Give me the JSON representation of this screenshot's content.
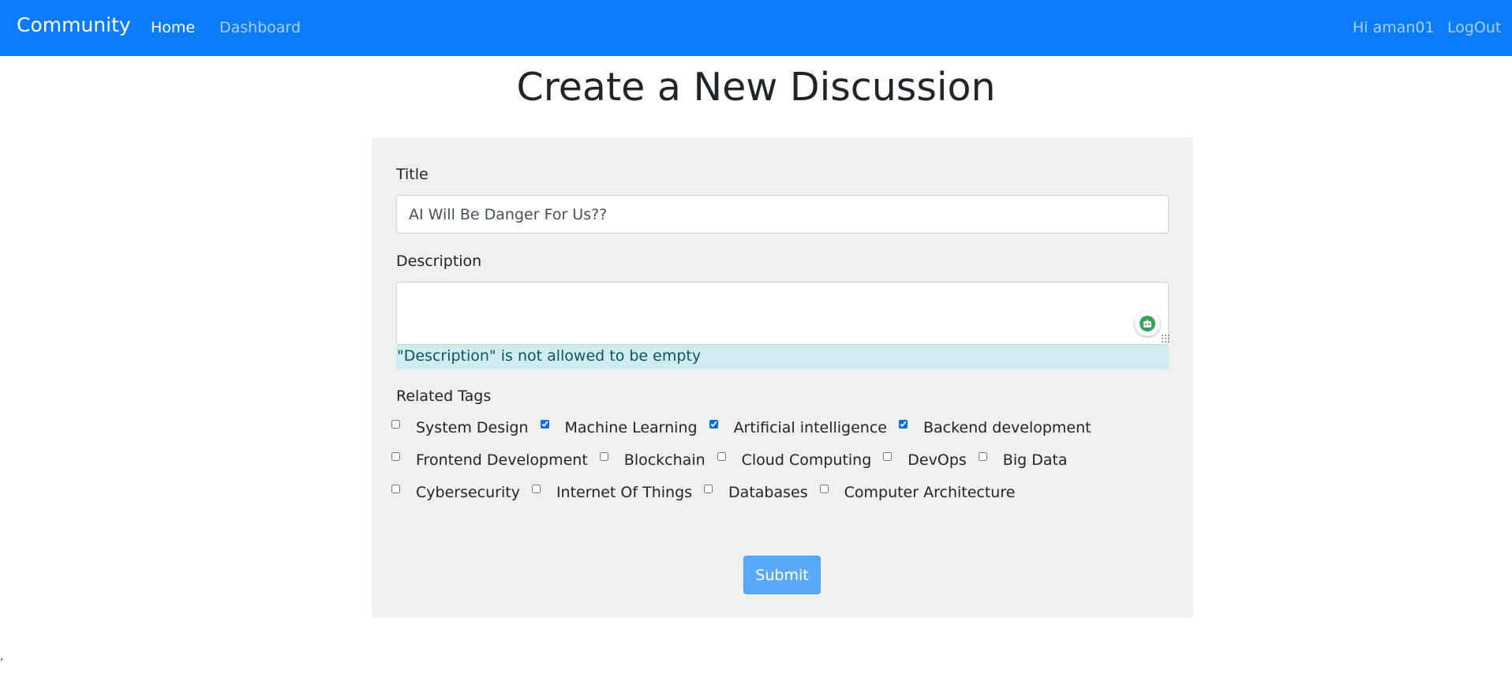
{
  "navbar": {
    "brand": "Community",
    "home": "Home",
    "dashboard": "Dashboard",
    "greeting": "Hi aman01",
    "logout": "LogOut",
    "bg_color": "#0b7cf9"
  },
  "page": {
    "title": "Create a New Discussion"
  },
  "form": {
    "title_label": "Title",
    "title_value": "AI Will Be Danger For Us??",
    "description_label": "Description",
    "description_value": "",
    "description_error": "\"Description\" is not allowed to be empty",
    "tags_label": "Related Tags",
    "tags": [
      {
        "label": "System Design",
        "checked": false
      },
      {
        "label": "Machine Learning",
        "checked": true
      },
      {
        "label": "Artificial intelligence",
        "checked": true
      },
      {
        "label": "Backend development",
        "checked": true
      },
      {
        "label": "Frontend Development",
        "checked": false
      },
      {
        "label": "Blockchain",
        "checked": false
      },
      {
        "label": "Cloud Computing",
        "checked": false
      },
      {
        "label": "DevOps",
        "checked": false
      },
      {
        "label": "Big Data",
        "checked": false
      },
      {
        "label": "Cybersecurity",
        "checked": false
      },
      {
        "label": "Internet Of Things",
        "checked": false
      },
      {
        "label": "Databases",
        "checked": false
      },
      {
        "label": "Computer Architecture",
        "checked": false
      }
    ],
    "submit_label": "Submit",
    "accent_color": "#5aa9f8"
  },
  "footer": {
    "stray_mark": ","
  },
  "icons": {
    "assistant": "assistant-bot-icon",
    "resize": "resize-grip-icon"
  }
}
